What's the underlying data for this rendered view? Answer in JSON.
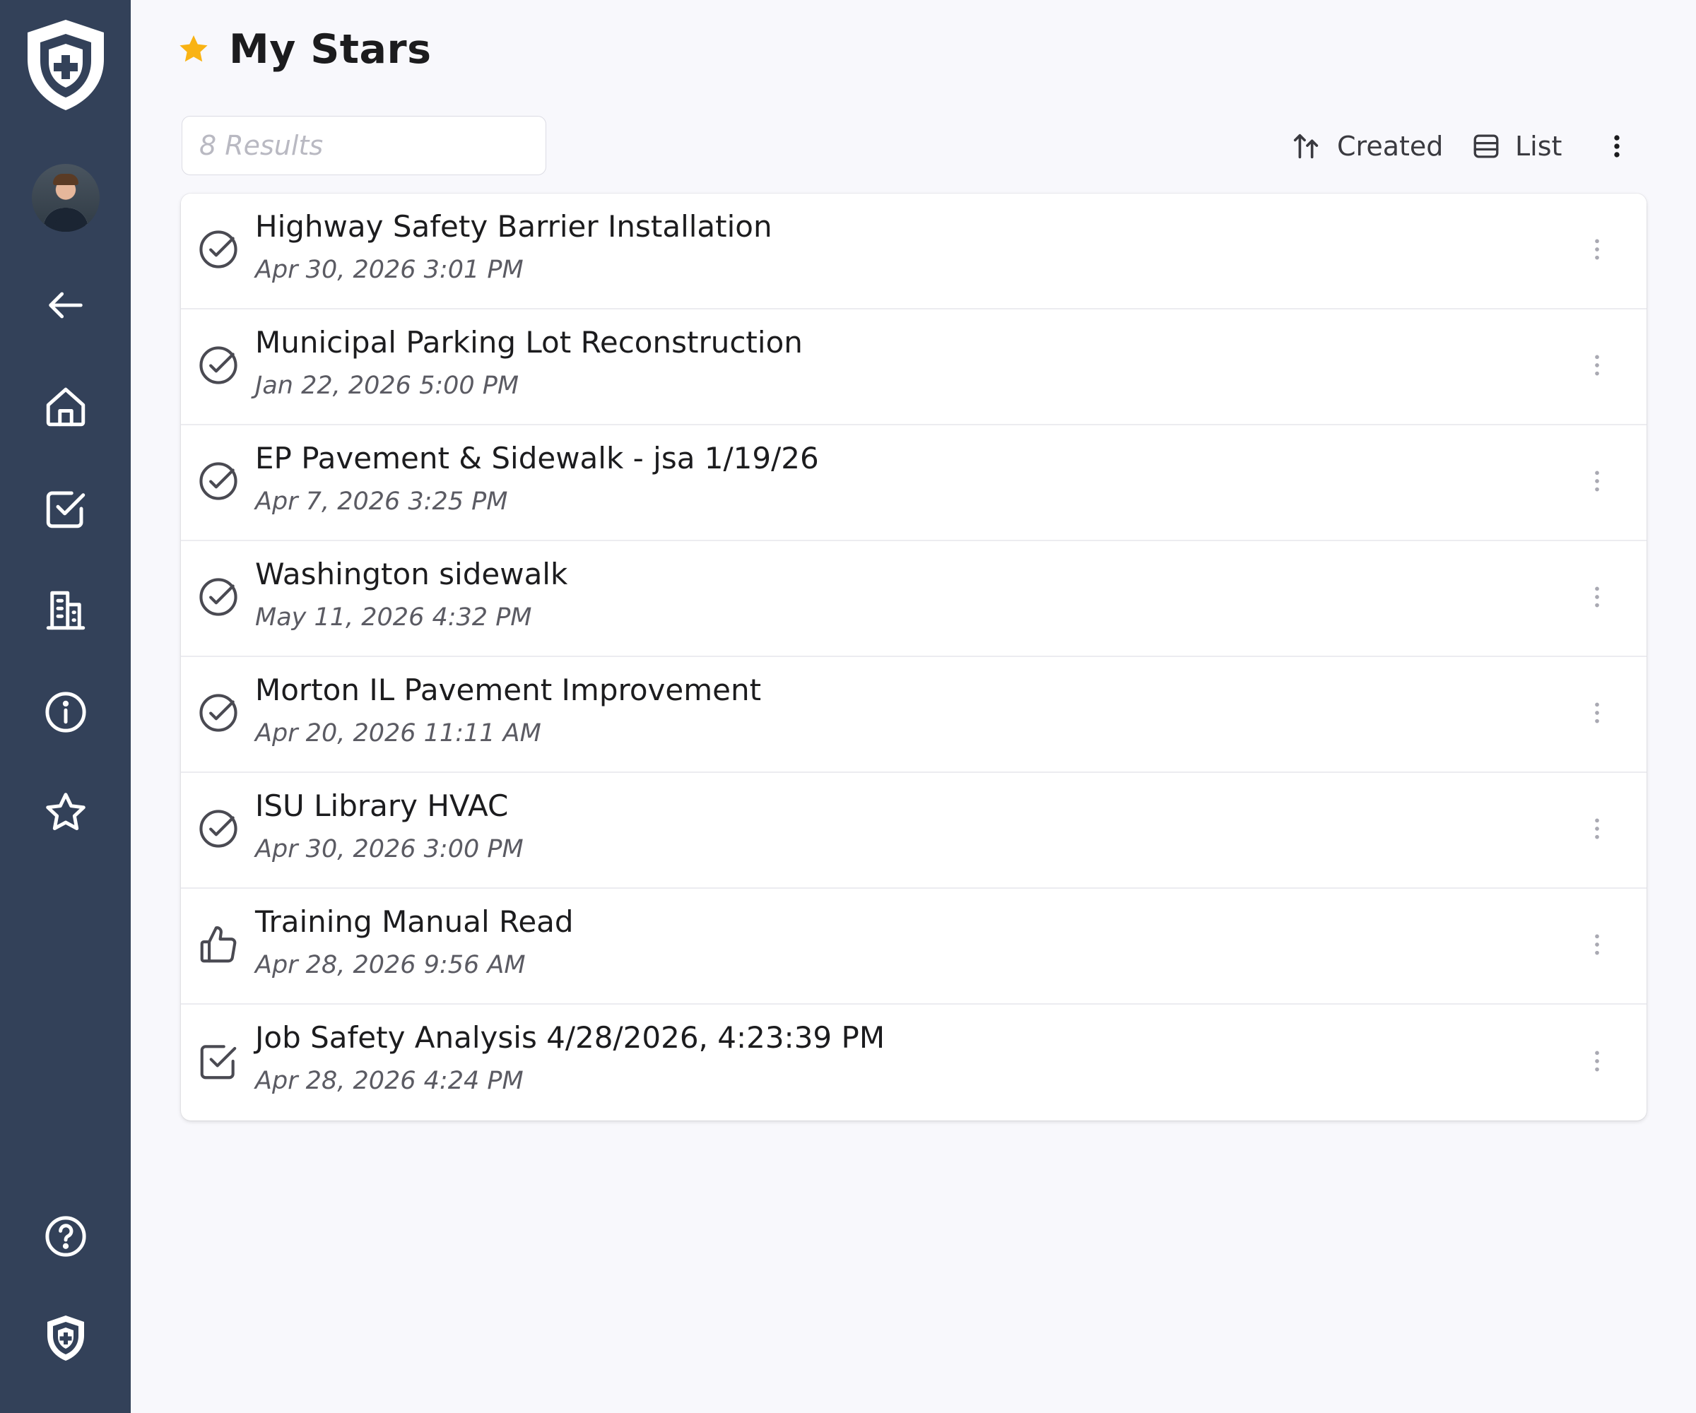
{
  "page": {
    "title": "My Stars",
    "title_icon": "star-icon",
    "accent": "#f9b314"
  },
  "sidebar": {
    "background": "#334159",
    "items": [
      {
        "name": "logo",
        "icon": "shield-logo-icon"
      },
      {
        "name": "avatar",
        "icon": "user-avatar"
      },
      {
        "name": "back",
        "icon": "arrow-left-icon"
      },
      {
        "name": "home",
        "icon": "home-icon"
      },
      {
        "name": "tasks",
        "icon": "checkbox-icon"
      },
      {
        "name": "buildings",
        "icon": "building-icon"
      },
      {
        "name": "info",
        "icon": "info-icon"
      },
      {
        "name": "stars",
        "icon": "star-outline-icon"
      },
      {
        "name": "help",
        "icon": "help-icon"
      },
      {
        "name": "brand",
        "icon": "shield-small-icon"
      }
    ]
  },
  "search": {
    "placeholder": "8 Results",
    "value": ""
  },
  "toolbar": {
    "sort_label": "Created",
    "sort_icon": "sort-arrows-icon",
    "view_label": "List",
    "view_icon": "list-view-icon",
    "more_icon": "vertical-dots-icon"
  },
  "items": [
    {
      "title": "Highway Safety Barrier Installation",
      "date": "Apr 30, 2026 3:01 PM",
      "icon": "circle-check-icon"
    },
    {
      "title": "Municipal Parking Lot Reconstruction",
      "date": "Jan 22, 2026 5:00 PM",
      "icon": "circle-check-icon"
    },
    {
      "title": "EP Pavement & Sidewalk - jsa 1/19/26",
      "date": "Apr 7, 2026 3:25 PM",
      "icon": "circle-check-icon"
    },
    {
      "title": "Washington sidewalk",
      "date": "May 11, 2026 4:32 PM",
      "icon": "circle-check-icon"
    },
    {
      "title": "Morton IL Pavement Improvement",
      "date": "Apr 20, 2026 11:11 AM",
      "icon": "circle-check-icon"
    },
    {
      "title": "ISU Library HVAC",
      "date": "Apr 30, 2026 3:00 PM",
      "icon": "circle-check-icon"
    },
    {
      "title": "Training Manual Read",
      "date": "Apr 28, 2026 9:56 AM",
      "icon": "thumbs-up-icon"
    },
    {
      "title": "Job Safety Analysis 4/28/2026, 4:23:39 PM",
      "date": "Apr 28, 2026 4:24 PM",
      "icon": "square-check-icon"
    }
  ]
}
